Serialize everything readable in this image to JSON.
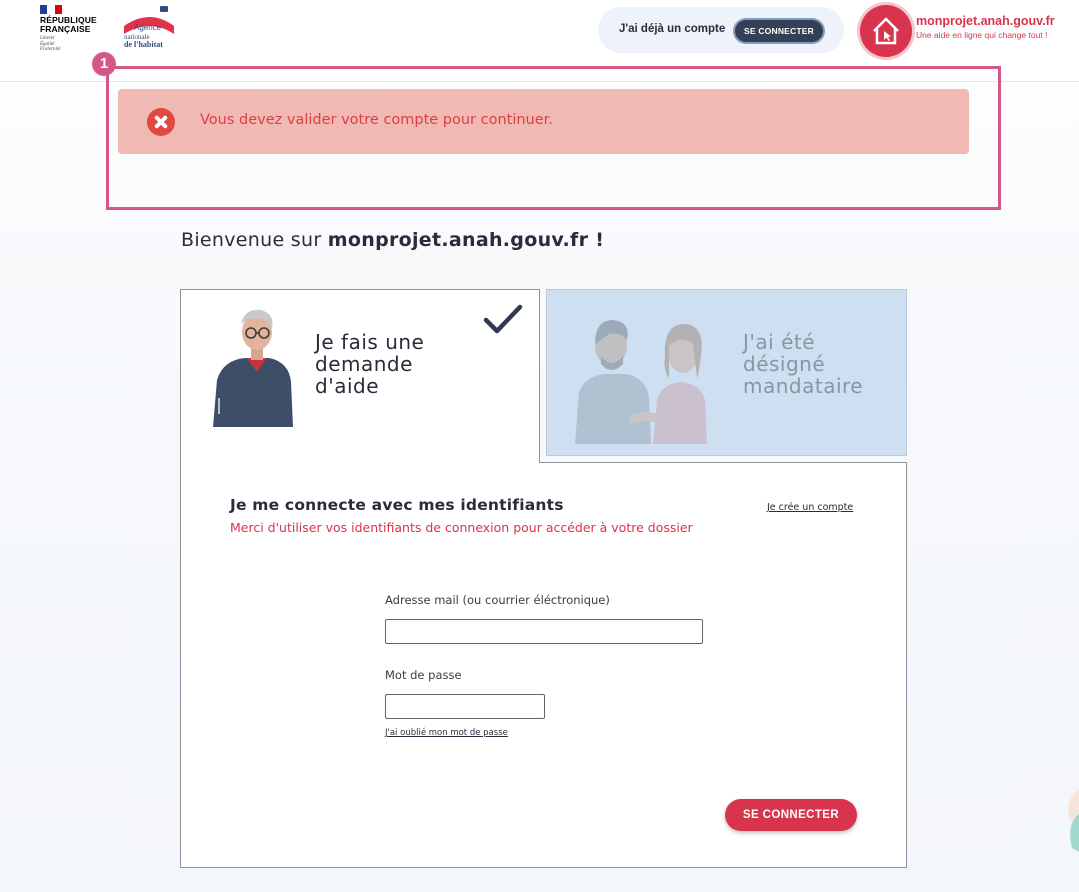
{
  "header": {
    "republic": [
      "RÉPUBLIQUE",
      "FRANÇAISE"
    ],
    "motto": [
      "Liberté",
      "Égalité",
      "Fraternité"
    ],
    "agency": {
      "agence": "Agence",
      "line2": "nationale",
      "line3": "de l'habitat"
    },
    "account_prompt": "J'ai déjà un compte",
    "connect_small": "SE CONNECTER",
    "brand_title": "monprojet.anah.gouv.fr",
    "brand_subtitle": "Une aide en ligne qui change tout !"
  },
  "annotation": {
    "number": "1"
  },
  "alert": {
    "message": "Vous devez valider votre compte pour continuer."
  },
  "welcome": {
    "prefix": "Bienvenue sur ",
    "site": "monprojet.anah.gouv.fr !"
  },
  "tabs": {
    "request": {
      "lines": [
        "Je fais une",
        "demande",
        "d'aide"
      ]
    },
    "proxy": {
      "lines": [
        "J'ai été",
        "désigné",
        "mandataire"
      ]
    }
  },
  "form": {
    "title": "Je me connecte avec mes identifiants",
    "subtitle": "Merci d'utiliser vos identifiants de connexion pour accéder à votre dossier",
    "create_account": "Je crée un compte",
    "email_label": "Adresse mail (ou courrier éléctronique)",
    "email_value": "",
    "password_label": "Mot de passe",
    "password_value": "",
    "forgot_password": "J'ai oublié mon mot de passe",
    "submit": "SE CONNECTER"
  },
  "colors": {
    "accent": "#d9344d",
    "alert_bg": "#f0b9b4",
    "alert_text": "#df3e45",
    "dark_button": "#344055",
    "annotation": "#d4578a",
    "inactive_tab": "#cddff0"
  }
}
